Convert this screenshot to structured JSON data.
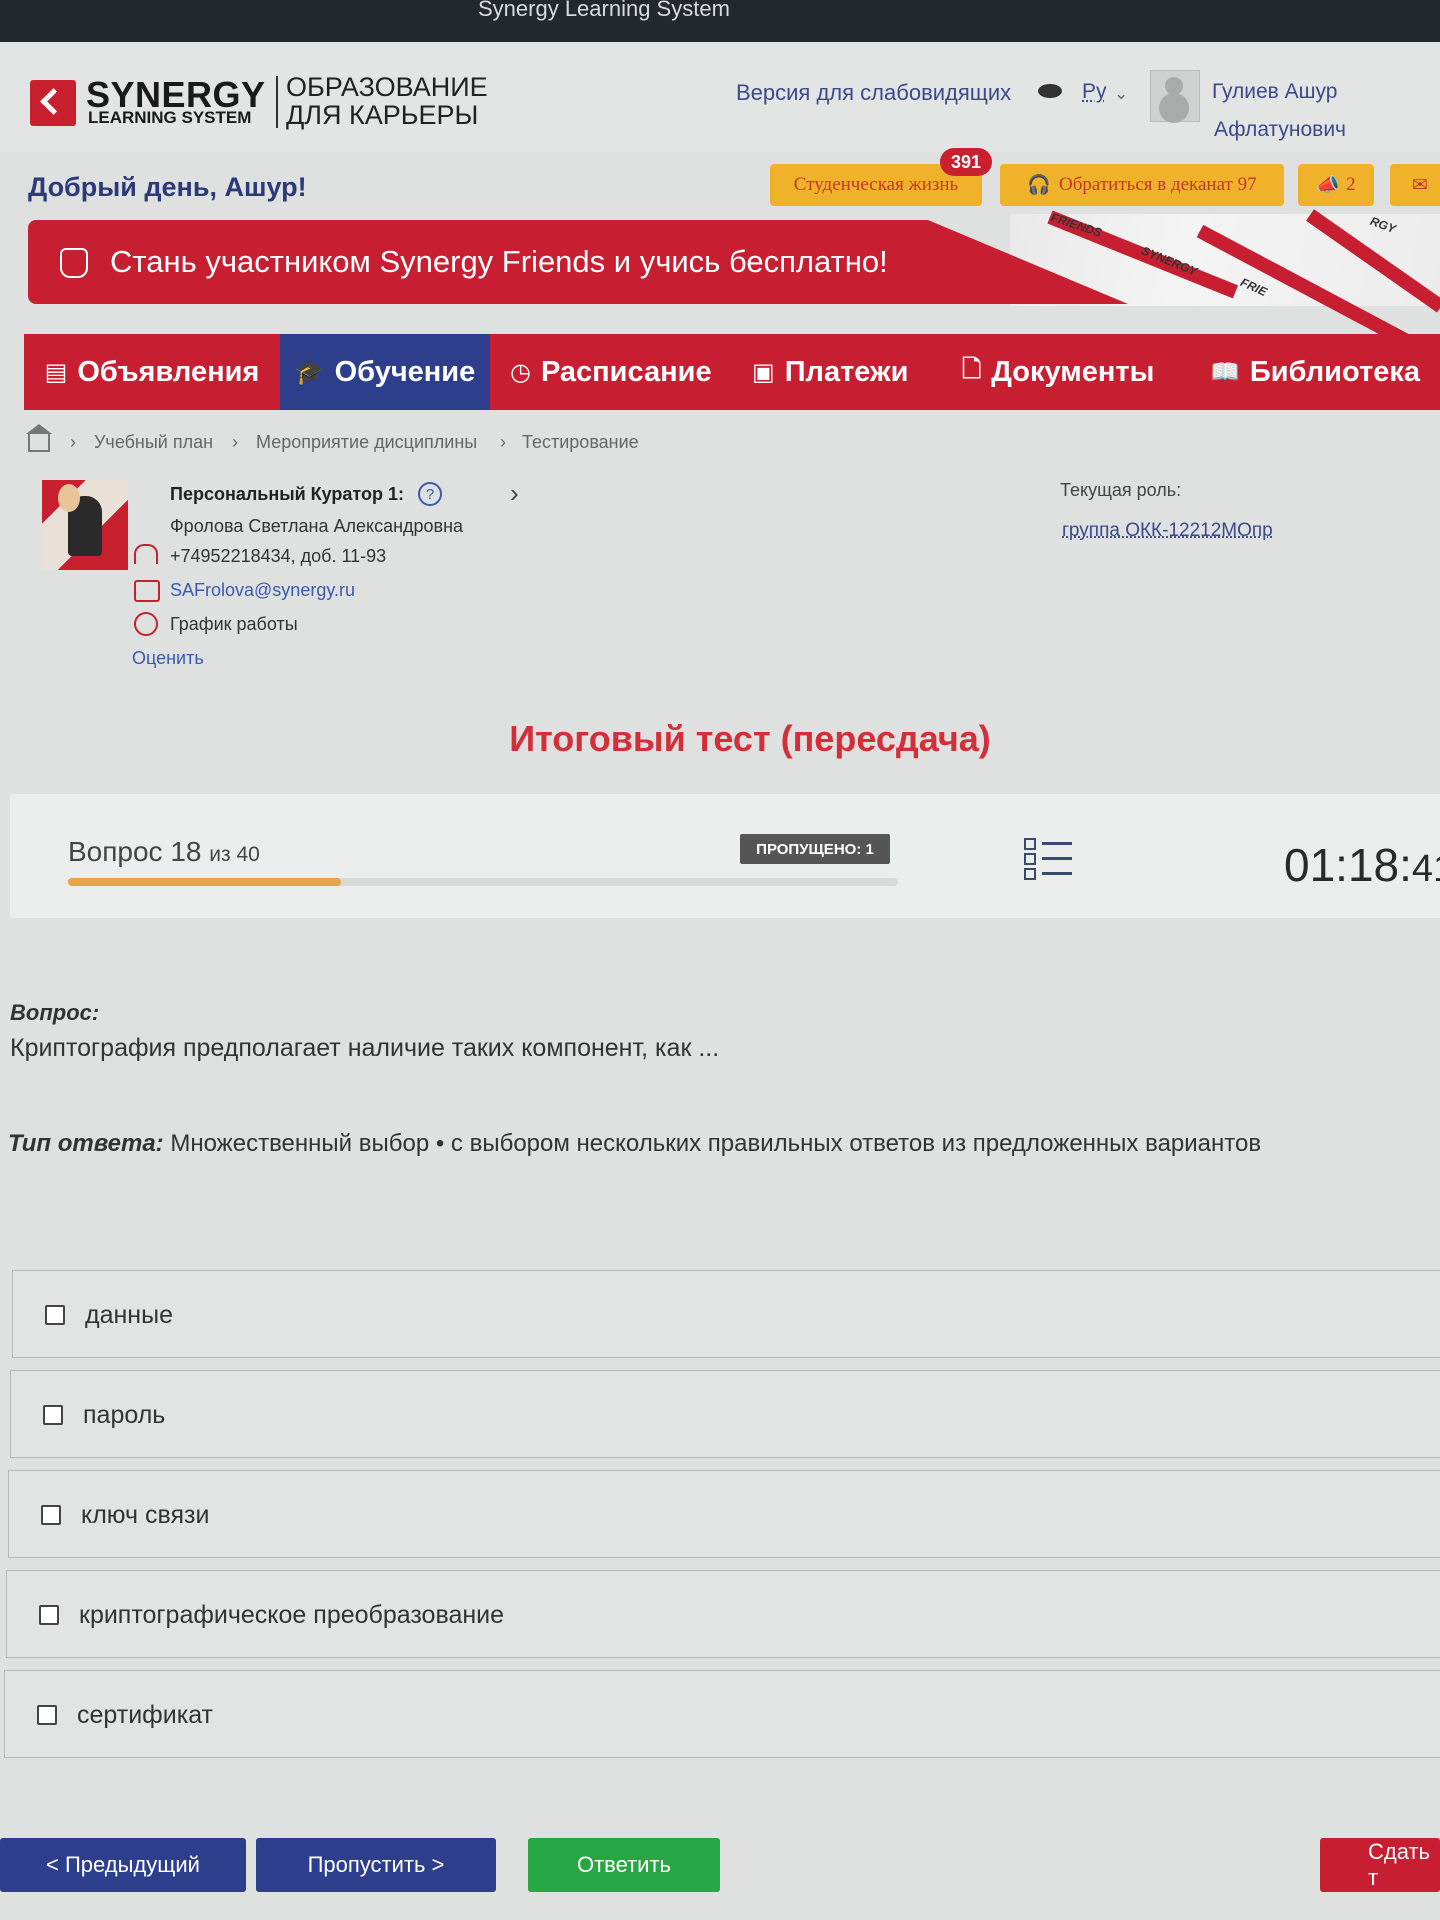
{
  "window": {
    "title": "Synergy Learning System"
  },
  "logo": {
    "brand": "SYNERGY",
    "sub": "LEARNING SYSTEM",
    "edu_line1": "ОБРАЗОВАНИЕ",
    "edu_line2": "ДЛЯ КАРЬЕРЫ"
  },
  "header": {
    "vision_link": "Версия для слабовидящих",
    "lang": "Ру",
    "user_line1": "Гулиев Ашур",
    "user_line2": "Афлатунович",
    "greeting": "Добрый день, Ашур!",
    "student_life": "Студенческая жизнь",
    "student_life_badge": "391",
    "dean": "Обратиться в деканат 97",
    "notif_count": "2"
  },
  "promo": {
    "text": "Стань участником Synergy Friends и учись бесплатно!",
    "tag1": "FRIENDS",
    "tag2": "SYNERGY",
    "tag3": "RGY",
    "tag4": "FRIE"
  },
  "nav": [
    {
      "label": "Объявления",
      "icon": "list-icon"
    },
    {
      "label": "Обучение",
      "icon": "graduation-cap-icon"
    },
    {
      "label": "Расписание",
      "icon": "clock-icon"
    },
    {
      "label": "Платежи",
      "icon": "money-icon"
    },
    {
      "label": "Документы",
      "icon": "document-icon"
    },
    {
      "label": "Библиотека",
      "icon": "book-icon"
    }
  ],
  "breadcrumb": [
    "Учебный план",
    "Мероприятие дисциплины",
    "Тестирование"
  ],
  "curator": {
    "title": "Персональный Куратор 1:",
    "name": "Фролова Светлана Александровна",
    "phone": "+74952218434, доб. 11-93",
    "email": "SAFrolova@synergy.ru",
    "schedule": "График работы",
    "rate": "Оценить"
  },
  "role": {
    "label": "Текущая роль:",
    "value": "группа ОКК-12212МОпр"
  },
  "test": {
    "title": "Итоговый тест (пересдача)",
    "question_label": "Вопрос",
    "question_num": "18",
    "question_of": "из 40",
    "progress": 0.45,
    "skipped": "ПРОПУЩЕНО: 1",
    "timer_main": "01:18:",
    "timer_sec": "41"
  },
  "question": {
    "head": "Вопрос:",
    "text": "Криптография предполагает наличие таких компонент, как ...",
    "type_label": "Тип ответа:",
    "type_text": "Множественный выбор • с выбором нескольких правильных ответов из предложенных вариантов"
  },
  "options": [
    "данные",
    "пароль",
    "ключ связи",
    "криптографическое преобразование",
    "сертификат"
  ],
  "buttons": {
    "prev": "< Предыдущий",
    "skip": "Пропустить >",
    "answer": "Ответить",
    "submit": "Сдать т"
  },
  "colors": {
    "brand_red": "#c81e32",
    "nav_active": "#2d3e8c",
    "progress": "#e8a44a",
    "answer_green": "#27a744"
  }
}
